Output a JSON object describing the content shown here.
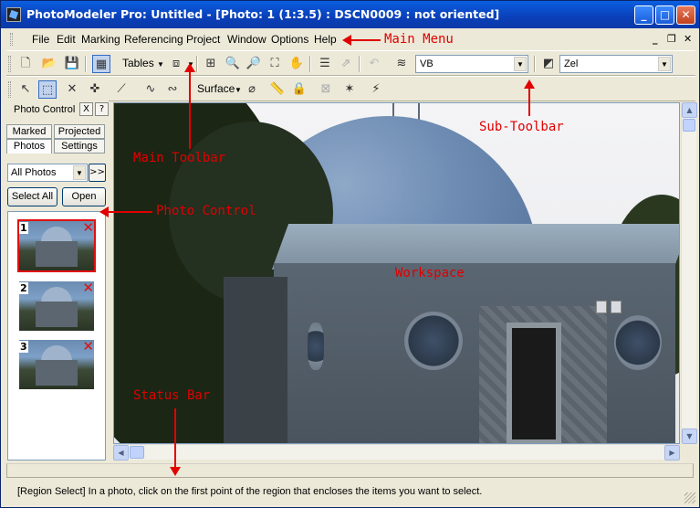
{
  "window": {
    "title": "PhotoModeler Pro: Untitled - [Photo: 1 (1:3.5) : DSCN0009 : not oriented]",
    "min": "_",
    "max": "□",
    "close": "✕"
  },
  "menu": {
    "items": [
      "File",
      "Edit",
      "Marking",
      "Referencing",
      "Project",
      "Window",
      "Options",
      "Help"
    ],
    "mdi_minimize": "_",
    "mdi_restore": "❐",
    "mdi_close": "✕"
  },
  "toolbar": {
    "tables_label": "Tables",
    "surface_label": "Surface",
    "layer_combo": "VB",
    "color_combo": "Zel"
  },
  "photo_control": {
    "title": "Photo Control",
    "close": "X",
    "help": "?",
    "tabs": [
      "Marked",
      "Projected",
      "Photos",
      "Settings"
    ],
    "filter_value": "All Photos",
    "more": ">>",
    "select_all": "Select All",
    "open": "Open",
    "thumbs": [
      {
        "num": "1",
        "mark": "✕"
      },
      {
        "num": "2",
        "mark": "✕"
      },
      {
        "num": "3",
        "mark": "✕"
      }
    ]
  },
  "status": {
    "text": "[Region Select] In a photo, click on the first point of the region that encloses the items you want to select."
  },
  "annotations": {
    "main_menu": "Main Menu",
    "sub_toolbar": "Sub-Toolbar",
    "main_toolbar": "Main Toolbar",
    "photo_control": "Photo Control",
    "workspace": "Workspace",
    "status_bar": "Status Bar"
  },
  "colors": {
    "annotation": "#e00000",
    "titlebar": "#0a4fd0",
    "thumb_selected": "#e01010"
  }
}
